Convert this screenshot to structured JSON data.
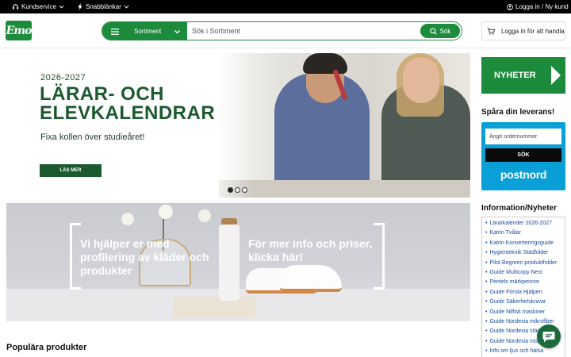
{
  "topbar": {
    "customer_service": "Kundservice",
    "quick_links": "Snabblänkar",
    "login": "Logga in / Ny kund"
  },
  "header": {
    "logo_text": "Emo",
    "category_label": "Sortiment",
    "search_placeholder": "Sök i Sortiment",
    "search_button": "Sök",
    "login_button": "Logga in för att handla"
  },
  "hero": {
    "year": "2026-2027",
    "title_line1": "LÄRAR- OCH",
    "title_line2": "ELEVKALENDRAR",
    "subtitle": "Fixa kollen över studieåret!",
    "cta": "LÄS MER",
    "slides_total": 3,
    "active_slide": 1
  },
  "banner": {
    "text_left": "Vi hjälper er med profilering av kläder och produkter",
    "text_right": "För mer info och priser, klicka här!"
  },
  "main": {
    "popular_heading": "Populära produkter"
  },
  "sidebar": {
    "nyheter_button": "NYHETER",
    "track_title": "Spåra din leverans!",
    "order_placeholder": "Ange ordernummer",
    "track_button": "SÖK",
    "carrier": "postnord",
    "info_title": "Information/Nyheter",
    "info_items": [
      "Lärarkalender 2026-2027",
      "Katrin Tvålar",
      "Katrin Konverteringsguide",
      "Hygienteknik Städfolder",
      "Pilot Begreen produktfolder",
      "Guide Multicopy Next",
      "Pentels märkpennor",
      "Guide Första Hjälpen",
      "Guide Säkerhetsknivar",
      "Guide Nilfisk maskiner",
      "Guide Nordexia mikrofiber",
      "Guide Nordexia städ",
      "Guide Nordexia mopp",
      "Info om ljus och hälsa"
    ]
  },
  "colors": {
    "brand_green": "#1c8c3c",
    "dark_green": "#1b5a2e",
    "postnord_blue": "#0a9fd6",
    "link_blue": "#1a4ea0"
  }
}
